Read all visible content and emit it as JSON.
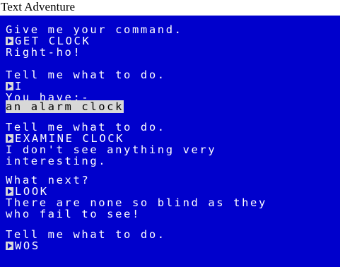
{
  "window": {
    "title": "Text Adventure"
  },
  "colors": {
    "screen_background": "#0000cc",
    "text": "#ffffff",
    "highlight_background": "#d8d8d8",
    "highlight_text": "#000000"
  },
  "transcript": {
    "block1": {
      "prompt": "Give me your command.",
      "command": "GET CLOCK",
      "response": "Right-ho!"
    },
    "block2": {
      "prompt": "Tell me what to do.",
      "command": "I",
      "inventory_header": "You have:-",
      "inventory_item": "an alarm clock"
    },
    "block3": {
      "prompt": "Tell me what to do.",
      "command": "EXAMINE CLOCK",
      "response_line1": "I don't see anything very",
      "response_line2": "interesting."
    },
    "block4": {
      "prompt": "What next?",
      "command": "LOOK",
      "response_line1": "There are none so blind as they",
      "response_line2": "who fail to see!"
    },
    "block5": {
      "prompt": "Tell me what to do.",
      "command": "WOS"
    }
  },
  "icons": {
    "prompt_marker": "prompt-arrow-icon"
  }
}
